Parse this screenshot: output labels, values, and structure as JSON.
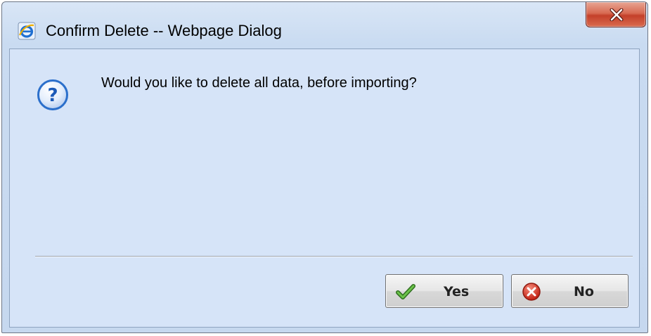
{
  "window": {
    "title": "Confirm Delete -- Webpage Dialog",
    "title_icon": "internet-explorer-icon",
    "close_icon": "close-icon"
  },
  "dialog": {
    "icon": "question-icon",
    "message": "Would you like to delete all data, before importing?"
  },
  "buttons": {
    "yes": {
      "label": "Yes",
      "icon": "checkmark-icon"
    },
    "no": {
      "label": "No",
      "icon": "cancel-icon"
    }
  },
  "colors": {
    "client_background": "#d6e4f8",
    "close_button": "#c94a34",
    "question_icon": "#2b6fcb"
  }
}
